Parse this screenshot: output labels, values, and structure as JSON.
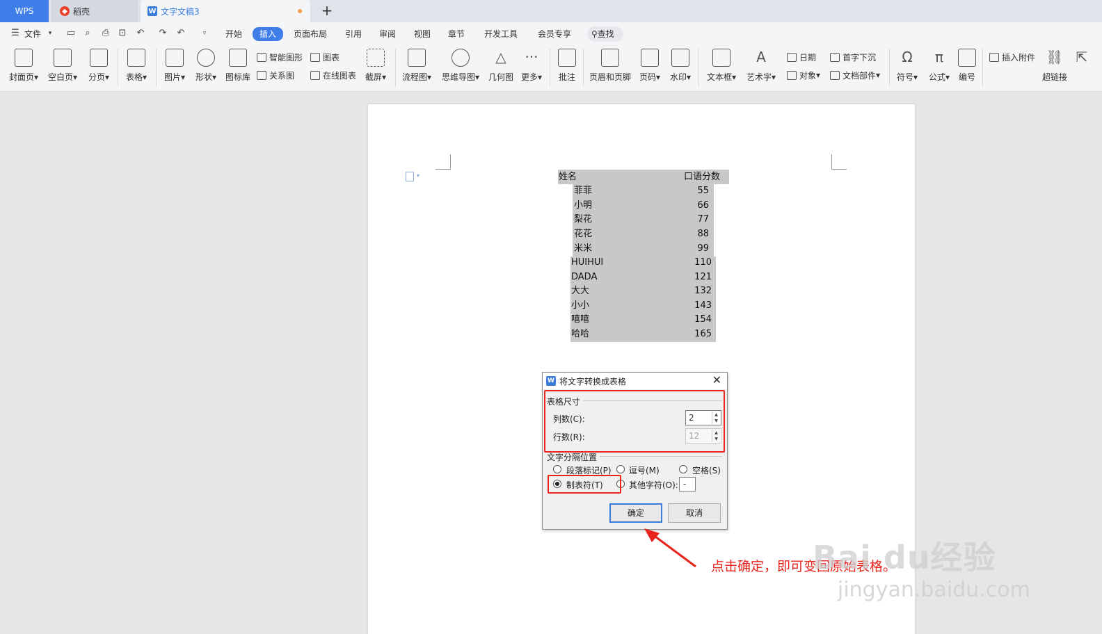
{
  "tabs": {
    "wps": "WPS",
    "daoke": "稻壳",
    "document": "文字文稿3",
    "add": "+"
  },
  "menu": {
    "file": "文件",
    "items": [
      "开始",
      "插入",
      "页面布局",
      "引用",
      "审阅",
      "视图",
      "章节",
      "开发工具",
      "会员专享"
    ],
    "active": "插入",
    "search": "查找"
  },
  "ribbon": {
    "cover": "封面页",
    "blank": "空白页",
    "pagebreak": "分页",
    "table": "表格",
    "picture": "图片",
    "shape": "形状",
    "iconlib": "图标库",
    "smartart": "智能图形",
    "chart": "图表",
    "relation": "关系图",
    "onlinechart": "在线图表",
    "screenshot": "截屏",
    "flowchart": "流程图",
    "mindmap": "思维导图",
    "geometry": "几何图",
    "more": "更多",
    "comment": "批注",
    "headerfooter": "页眉和页脚",
    "pagenum": "页码",
    "watermark": "水印",
    "textbox": "文本框",
    "wordart": "艺术字",
    "date": "日期",
    "object": "对象",
    "dropcap": "首字下沉",
    "docpart": "文档部件",
    "symbol": "符号",
    "formula": "公式",
    "numbering": "编号",
    "attach": "插入附件",
    "hyperlink": "超链接"
  },
  "document": {
    "header": {
      "name": "姓名",
      "score": "口语分数"
    },
    "rows": [
      {
        "name": "菲菲",
        "score": "55"
      },
      {
        "name": "小明",
        "score": "66"
      },
      {
        "name": "梨花",
        "score": "77"
      },
      {
        "name": "花花",
        "score": "88"
      },
      {
        "name": "米米",
        "score": "99"
      },
      {
        "name": "HUIHUI",
        "score": "110"
      },
      {
        "name": "DADA",
        "score": "121"
      },
      {
        "name": "大大",
        "score": "132"
      },
      {
        "name": "小小",
        "score": "143"
      },
      {
        "name": "嘻嘻",
        "score": "154"
      },
      {
        "name": "哈哈",
        "score": "165"
      }
    ]
  },
  "dialog": {
    "title": "将文字转换成表格",
    "size_group": "表格尺寸",
    "columns_label": "列数(C):",
    "columns_value": "2",
    "rows_label": "行数(R):",
    "rows_value": "12",
    "sep_group": "文字分隔位置",
    "opt_paragraph": "段落标记(P)",
    "opt_comma": "逗号(M)",
    "opt_space": "空格(S)",
    "opt_tab": "制表符(T)",
    "opt_other": "其他字符(O):",
    "other_value": "-",
    "ok": "确定",
    "cancel": "取消",
    "selected": "制表符(T)"
  },
  "annotation": {
    "text": "点击确定，即可变回原始表格。"
  },
  "watermark": {
    "main": "Bai du经验",
    "sub": "jingyan.baidu.com"
  },
  "colors": {
    "accent": "#3f7ee8",
    "annotation": "#e8231c",
    "highlight": "#c8c8c8"
  }
}
